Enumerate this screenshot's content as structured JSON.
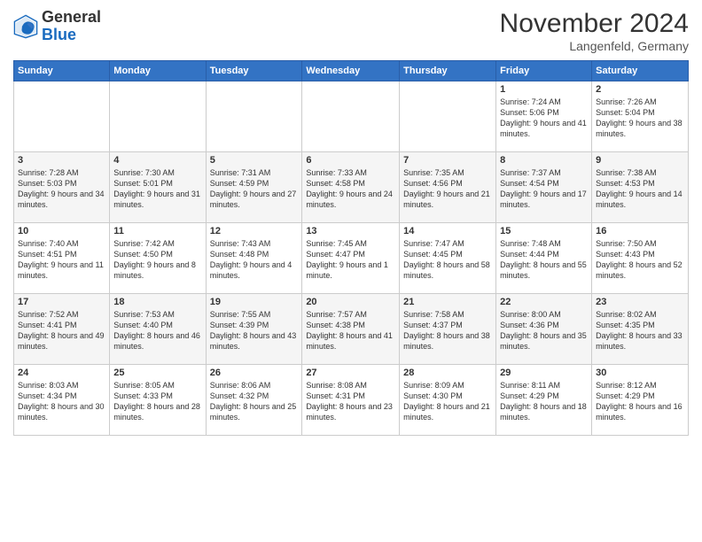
{
  "header": {
    "logo_general": "General",
    "logo_blue": "Blue",
    "month_title": "November 2024",
    "location": "Langenfeld, Germany"
  },
  "columns": [
    "Sunday",
    "Monday",
    "Tuesday",
    "Wednesday",
    "Thursday",
    "Friday",
    "Saturday"
  ],
  "weeks": [
    [
      {
        "day": "",
        "info": ""
      },
      {
        "day": "",
        "info": ""
      },
      {
        "day": "",
        "info": ""
      },
      {
        "day": "",
        "info": ""
      },
      {
        "day": "",
        "info": ""
      },
      {
        "day": "1",
        "info": "Sunrise: 7:24 AM\nSunset: 5:06 PM\nDaylight: 9 hours\nand 41 minutes."
      },
      {
        "day": "2",
        "info": "Sunrise: 7:26 AM\nSunset: 5:04 PM\nDaylight: 9 hours\nand 38 minutes."
      }
    ],
    [
      {
        "day": "3",
        "info": "Sunrise: 7:28 AM\nSunset: 5:03 PM\nDaylight: 9 hours\nand 34 minutes."
      },
      {
        "day": "4",
        "info": "Sunrise: 7:30 AM\nSunset: 5:01 PM\nDaylight: 9 hours\nand 31 minutes."
      },
      {
        "day": "5",
        "info": "Sunrise: 7:31 AM\nSunset: 4:59 PM\nDaylight: 9 hours\nand 27 minutes."
      },
      {
        "day": "6",
        "info": "Sunrise: 7:33 AM\nSunset: 4:58 PM\nDaylight: 9 hours\nand 24 minutes."
      },
      {
        "day": "7",
        "info": "Sunrise: 7:35 AM\nSunset: 4:56 PM\nDaylight: 9 hours\nand 21 minutes."
      },
      {
        "day": "8",
        "info": "Sunrise: 7:37 AM\nSunset: 4:54 PM\nDaylight: 9 hours\nand 17 minutes."
      },
      {
        "day": "9",
        "info": "Sunrise: 7:38 AM\nSunset: 4:53 PM\nDaylight: 9 hours\nand 14 minutes."
      }
    ],
    [
      {
        "day": "10",
        "info": "Sunrise: 7:40 AM\nSunset: 4:51 PM\nDaylight: 9 hours\nand 11 minutes."
      },
      {
        "day": "11",
        "info": "Sunrise: 7:42 AM\nSunset: 4:50 PM\nDaylight: 9 hours\nand 8 minutes."
      },
      {
        "day": "12",
        "info": "Sunrise: 7:43 AM\nSunset: 4:48 PM\nDaylight: 9 hours\nand 4 minutes."
      },
      {
        "day": "13",
        "info": "Sunrise: 7:45 AM\nSunset: 4:47 PM\nDaylight: 9 hours\nand 1 minute."
      },
      {
        "day": "14",
        "info": "Sunrise: 7:47 AM\nSunset: 4:45 PM\nDaylight: 8 hours\nand 58 minutes."
      },
      {
        "day": "15",
        "info": "Sunrise: 7:48 AM\nSunset: 4:44 PM\nDaylight: 8 hours\nand 55 minutes."
      },
      {
        "day": "16",
        "info": "Sunrise: 7:50 AM\nSunset: 4:43 PM\nDaylight: 8 hours\nand 52 minutes."
      }
    ],
    [
      {
        "day": "17",
        "info": "Sunrise: 7:52 AM\nSunset: 4:41 PM\nDaylight: 8 hours\nand 49 minutes."
      },
      {
        "day": "18",
        "info": "Sunrise: 7:53 AM\nSunset: 4:40 PM\nDaylight: 8 hours\nand 46 minutes."
      },
      {
        "day": "19",
        "info": "Sunrise: 7:55 AM\nSunset: 4:39 PM\nDaylight: 8 hours\nand 43 minutes."
      },
      {
        "day": "20",
        "info": "Sunrise: 7:57 AM\nSunset: 4:38 PM\nDaylight: 8 hours\nand 41 minutes."
      },
      {
        "day": "21",
        "info": "Sunrise: 7:58 AM\nSunset: 4:37 PM\nDaylight: 8 hours\nand 38 minutes."
      },
      {
        "day": "22",
        "info": "Sunrise: 8:00 AM\nSunset: 4:36 PM\nDaylight: 8 hours\nand 35 minutes."
      },
      {
        "day": "23",
        "info": "Sunrise: 8:02 AM\nSunset: 4:35 PM\nDaylight: 8 hours\nand 33 minutes."
      }
    ],
    [
      {
        "day": "24",
        "info": "Sunrise: 8:03 AM\nSunset: 4:34 PM\nDaylight: 8 hours\nand 30 minutes."
      },
      {
        "day": "25",
        "info": "Sunrise: 8:05 AM\nSunset: 4:33 PM\nDaylight: 8 hours\nand 28 minutes."
      },
      {
        "day": "26",
        "info": "Sunrise: 8:06 AM\nSunset: 4:32 PM\nDaylight: 8 hours\nand 25 minutes."
      },
      {
        "day": "27",
        "info": "Sunrise: 8:08 AM\nSunset: 4:31 PM\nDaylight: 8 hours\nand 23 minutes."
      },
      {
        "day": "28",
        "info": "Sunrise: 8:09 AM\nSunset: 4:30 PM\nDaylight: 8 hours\nand 21 minutes."
      },
      {
        "day": "29",
        "info": "Sunrise: 8:11 AM\nSunset: 4:29 PM\nDaylight: 8 hours\nand 18 minutes."
      },
      {
        "day": "30",
        "info": "Sunrise: 8:12 AM\nSunset: 4:29 PM\nDaylight: 8 hours\nand 16 minutes."
      }
    ]
  ]
}
